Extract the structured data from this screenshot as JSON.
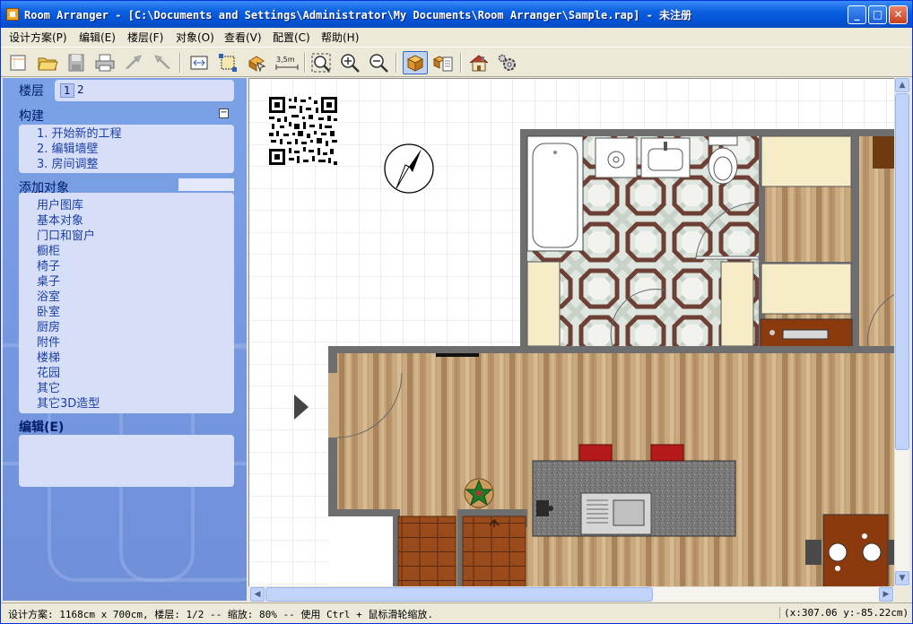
{
  "window": {
    "title": "Room Arranger - [C:\\Documents and Settings\\Administrator\\My Documents\\Room Arranger\\Sample.rap] - 未注册",
    "minimize_glyph": "_",
    "maximize_glyph": "□",
    "close_glyph": "✕"
  },
  "menu": [
    "设计方案(P)",
    "编辑(E)",
    "楼层(F)",
    "对象(O)",
    "查看(V)",
    "配置(C)",
    "帮助(H)"
  ],
  "toolbar": {
    "icons": [
      "new-icon",
      "open-icon",
      "save-icon",
      "print-icon",
      "undo-icon",
      "redo-icon",
      "plan-size-icon",
      "crop-icon",
      "move-objects-icon",
      "measure-icon",
      "zoom-fit-icon",
      "zoom-in-icon",
      "zoom-out-icon",
      "3d-box-icon",
      "object-list-icon",
      "house-3d-icon",
      "settings-gear-icon"
    ],
    "measure_label": "3,5m"
  },
  "sidebar": {
    "floors_label": "楼层",
    "floors": [
      "1",
      "2"
    ],
    "build_label": "构建",
    "collapse_glyph": "−",
    "build_steps": [
      "1. 开始新的工程",
      "2. 编辑墙壁",
      "3. 房间调整"
    ],
    "add_objects_label": "添加对象",
    "categories": [
      "用户图库",
      "基本对象",
      "门口和窗户",
      "橱柜",
      "椅子",
      "桌子",
      "浴室",
      "卧室",
      "厨房",
      "附件",
      "楼梯",
      "花园",
      "其它",
      "其它3D造型"
    ],
    "edit_label": "编辑(E)"
  },
  "colors": {
    "titlebar": "#0a5fe0",
    "sidebar_bg": "#7a96df",
    "panel_bg": "#d6dff7",
    "wall": "#6e6e6e",
    "wood_floor": "#c9a97e",
    "counter": "#787878",
    "chair_red": "#b51a1a",
    "table_brown": "#8b3a0e"
  },
  "status": {
    "left": "设计方案: 1168cm x 700cm, 楼层: 1/2 -- 缩放: 80% -- 使用 Ctrl + 鼠标滑轮缩放.",
    "right": "(x:307.06 y:-85.22cm)"
  }
}
